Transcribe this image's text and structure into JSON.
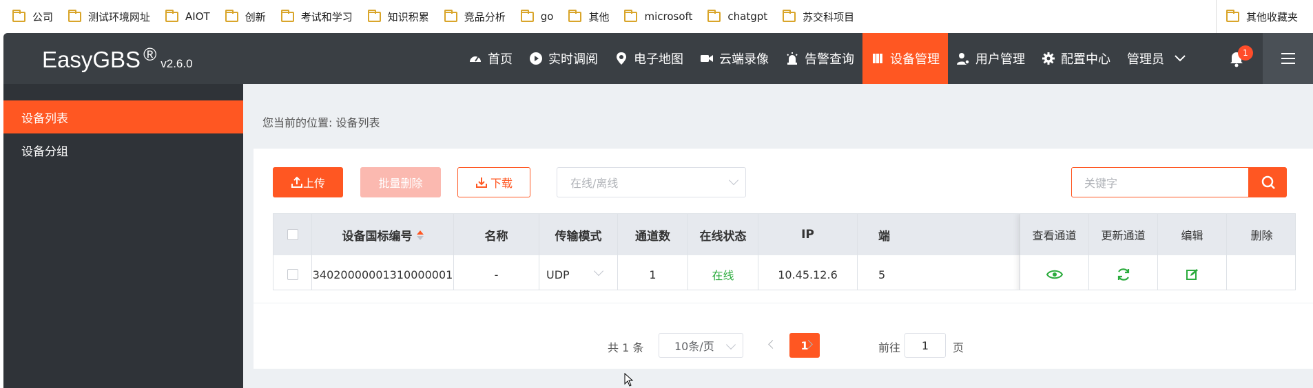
{
  "bookmarks": [
    "公司",
    "测试环境网址",
    "AIOT",
    "创新",
    "考试和学习",
    "知识积累",
    "竞品分析",
    "go",
    "其他",
    "microsoft",
    "chatgpt",
    "苏交科项目"
  ],
  "bookmarks_other": "其他收藏夹",
  "app": {
    "name": "EasyGBS",
    "reg": "®",
    "version": "v2.6.0"
  },
  "nav": {
    "home": "首页",
    "live": "实时调阅",
    "map": "电子地图",
    "record": "云端录像",
    "alarm": "告警查询",
    "devices": "设备管理",
    "users": "用户管理",
    "config": "配置中心",
    "admin": "管理员",
    "notify_count": "1"
  },
  "sidebar": {
    "items": [
      {
        "label": "设备列表"
      },
      {
        "label": "设备分组"
      }
    ]
  },
  "breadcrumb": "您当前的位置: 设备列表",
  "toolbar": {
    "upload": "上传",
    "batch_delete": "批量删除",
    "download": "下载",
    "status_placeholder": "在线/离线",
    "search_placeholder": "关键字"
  },
  "table": {
    "headers": {
      "device_id": "设备国标编号",
      "name": "名称",
      "transport": "传输模式",
      "channels": "通道数",
      "status": "在线状态",
      "ip": "IP",
      "port_partial": "端",
      "view": "查看通道",
      "refresh": "更新通道",
      "edit": "编辑",
      "delete": "删除"
    },
    "rows": [
      {
        "device_id": "34020000001310000001",
        "name": "-",
        "transport": "UDP",
        "channels": "1",
        "status": "在线",
        "ip": "10.45.12.6",
        "port_partial": "5"
      }
    ]
  },
  "pagination": {
    "total": "共 1 条",
    "page_size": "10条/页",
    "current": "1",
    "goto_label": "前往",
    "goto_value": "1",
    "goto_unit": "页"
  },
  "colors": {
    "accent": "#ff5722",
    "header_bg": "#3a3f44",
    "sidebar_bg": "#2f3338",
    "online": "#2bab3d"
  }
}
